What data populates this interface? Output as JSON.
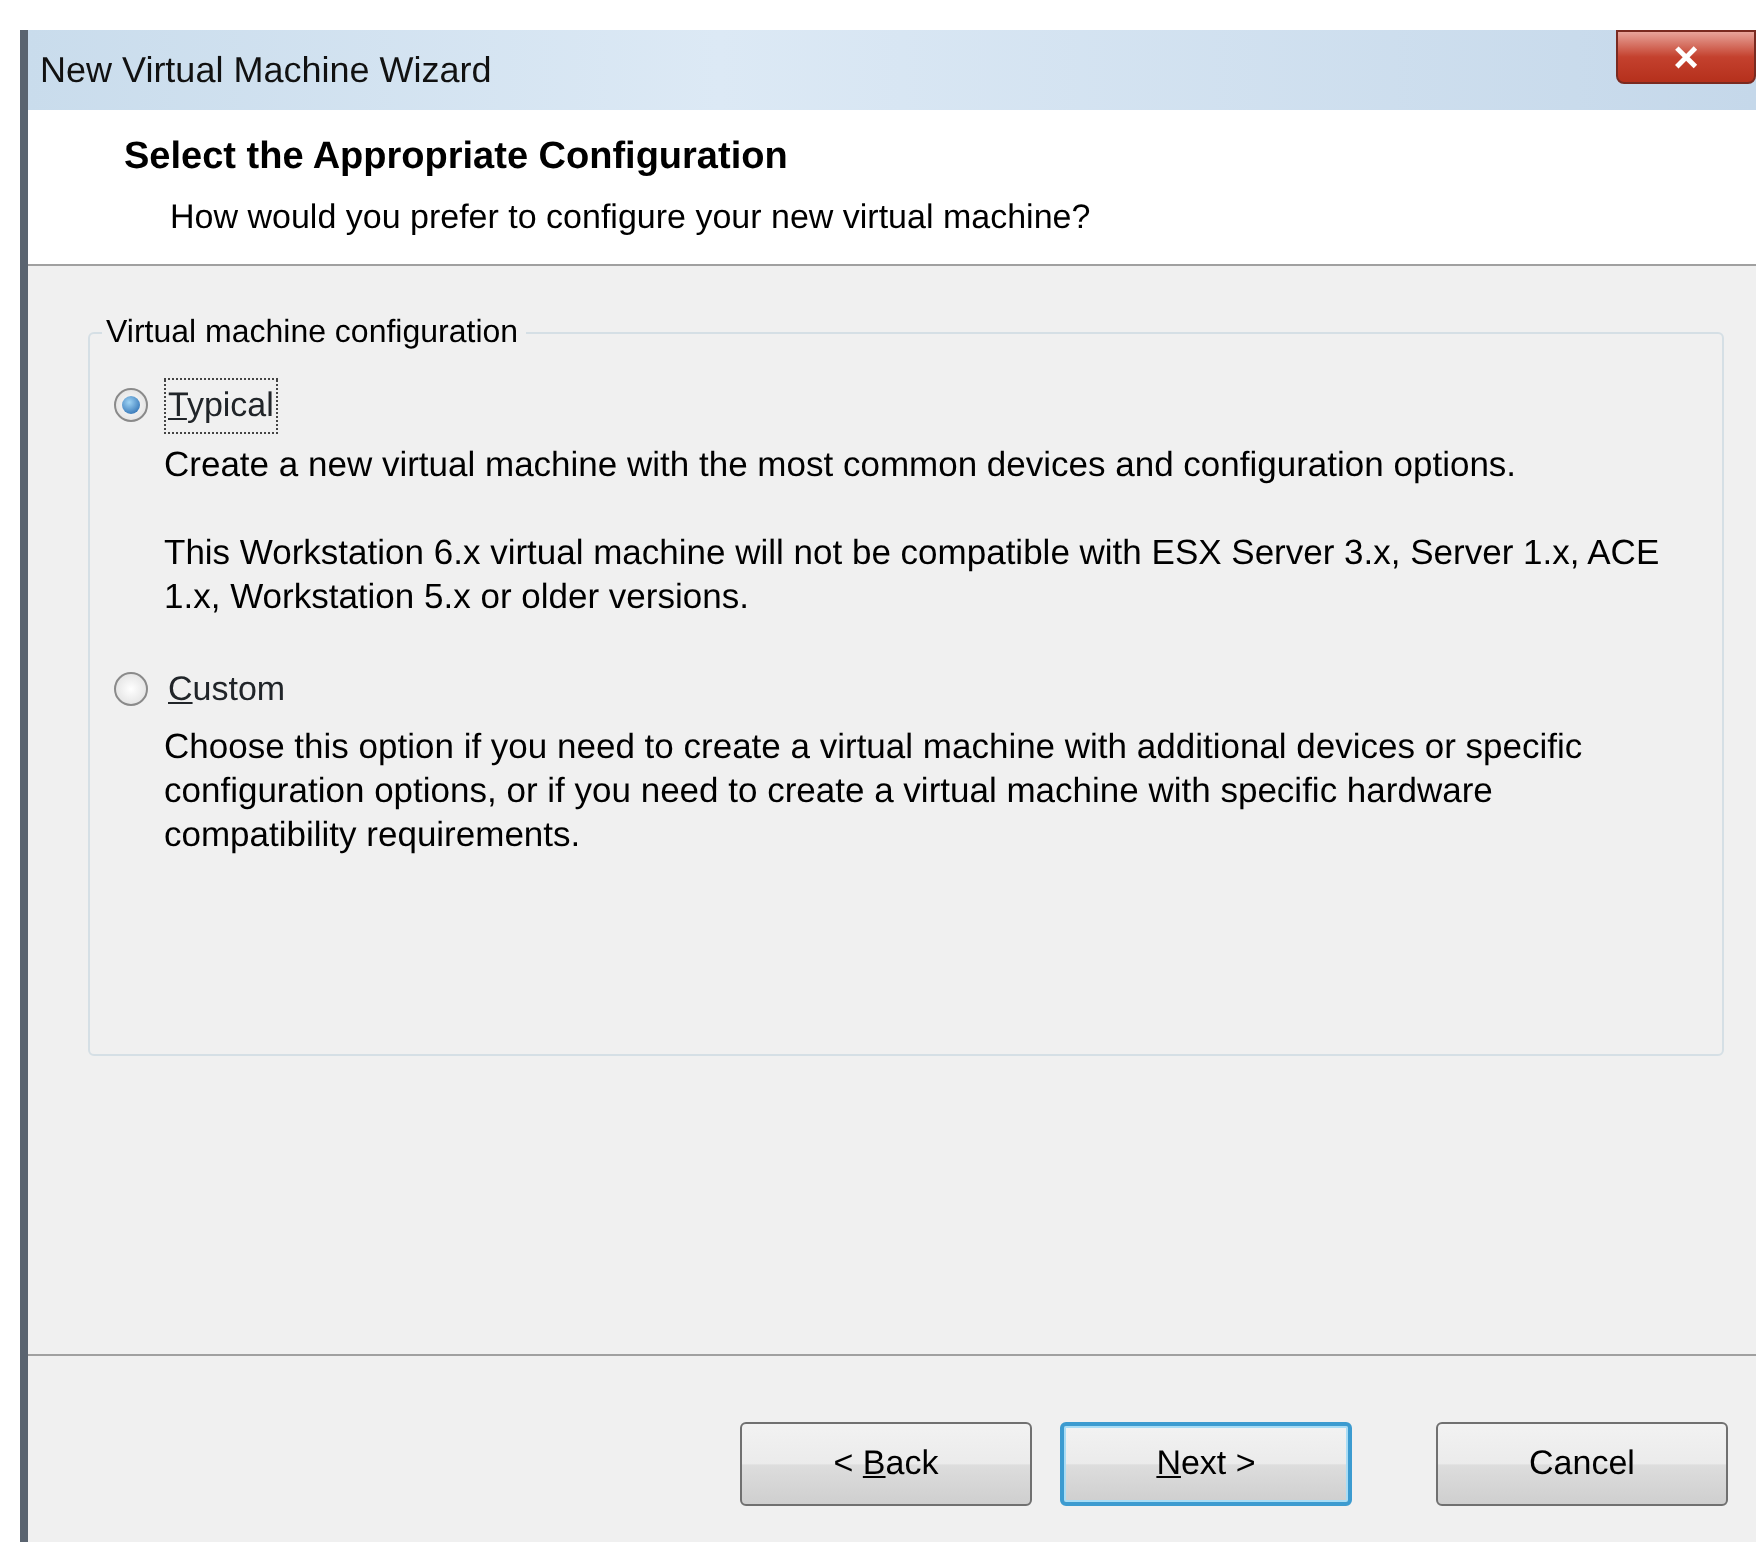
{
  "window": {
    "title": "New Virtual Machine Wizard",
    "close": "×"
  },
  "header": {
    "title": "Select the Appropriate Configuration",
    "subtitle": "How would you prefer to configure your new virtual machine?"
  },
  "group": {
    "label": "Virtual machine configuration",
    "options": [
      {
        "label": {
          "key": "T",
          "after": "ypical"
        },
        "selected": true,
        "focused": true,
        "paragraphs": [
          "Create a new virtual machine with the most common devices and configuration options.",
          "This Workstation 6.x virtual machine will not be compatible with ESX Server 3.x, Server 1.x, ACE 1.x, Workstation 5.x or older versions."
        ]
      },
      {
        "label": {
          "key": "C",
          "after": "ustom"
        },
        "selected": false,
        "focused": false,
        "paragraphs": [
          "Choose this option if you need to create a virtual machine with additional devices or specific configuration options, or if you need to create a virtual machine with specific hardware compatibility requirements."
        ]
      }
    ]
  },
  "buttons": [
    {
      "label": {
        "before": "< ",
        "key": "B",
        "after": "ack"
      },
      "default": false
    },
    {
      "label": {
        "key": "N",
        "after": "ext >"
      },
      "default": true
    },
    {
      "label": {
        "before": "Cancel"
      },
      "default": false
    }
  ]
}
